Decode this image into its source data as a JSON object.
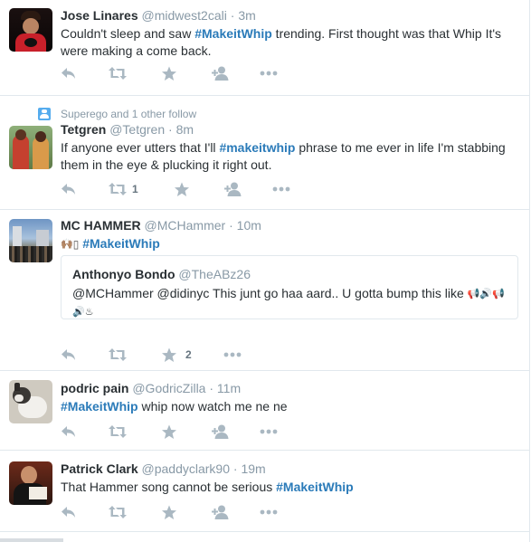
{
  "colors": {
    "hashtag": "#2b7bb9",
    "muted": "#8899a6",
    "action_icon": "#aab8c2",
    "border": "#e1e8ed",
    "context_icon": "#55acee"
  },
  "action_icons": [
    "reply-icon",
    "retweet-icon",
    "favorite-icon",
    "follow-icon",
    "more-icon"
  ],
  "tweets": [
    {
      "fullname": "Jose Linares",
      "handle": "@midwest2cali",
      "sep": "·",
      "time": "3m",
      "text_before": "Couldn't sleep and saw ",
      "hashtag": "#MakeitWhip",
      "text_after": " trending. First thought was that Whip It's were making a come back."
    },
    {
      "context": "Superego and 1 other follow",
      "fullname": "Tetgren",
      "handle": "@Tetgren",
      "sep": "·",
      "time": "8m",
      "text_before": "If anyone ever utters that I'll ",
      "hashtag": "#makeitwhip",
      "text_after": " phrase to me ever in life I'm stabbing them in the eye & plucking it right out.",
      "retweet_count": "1"
    },
    {
      "fullname": "MC HAMMER",
      "handle": "@MCHammer",
      "sep": "·",
      "time": "10m",
      "emoji": "🙌🏽",
      "box_glyph": "▯",
      "hashtag": "#MakeitWhip",
      "favorite_count": "2",
      "quote": {
        "fullname": "Anthonyo Bondo",
        "handle": "@TheABz26",
        "mention1": "@MCHammer",
        "mention2": "@didinyc",
        "text": " This junt go haa aard.. U gotta bump this like ",
        "emojis_line1": "📢🔊📢",
        "emojis_line2": "🔊♨"
      }
    },
    {
      "fullname": "podric pain",
      "handle": "@GodricZilla",
      "sep": "·",
      "time": "11m",
      "hashtag": "#MakeitWhip",
      "text_after": " whip now watch me ne ne"
    },
    {
      "fullname": "Patrick Clark",
      "handle": "@paddyclark90",
      "sep": "·",
      "time": "19m",
      "text_before": "That Hammer song cannot be serious ",
      "hashtag": "#MakeitWhip"
    }
  ]
}
